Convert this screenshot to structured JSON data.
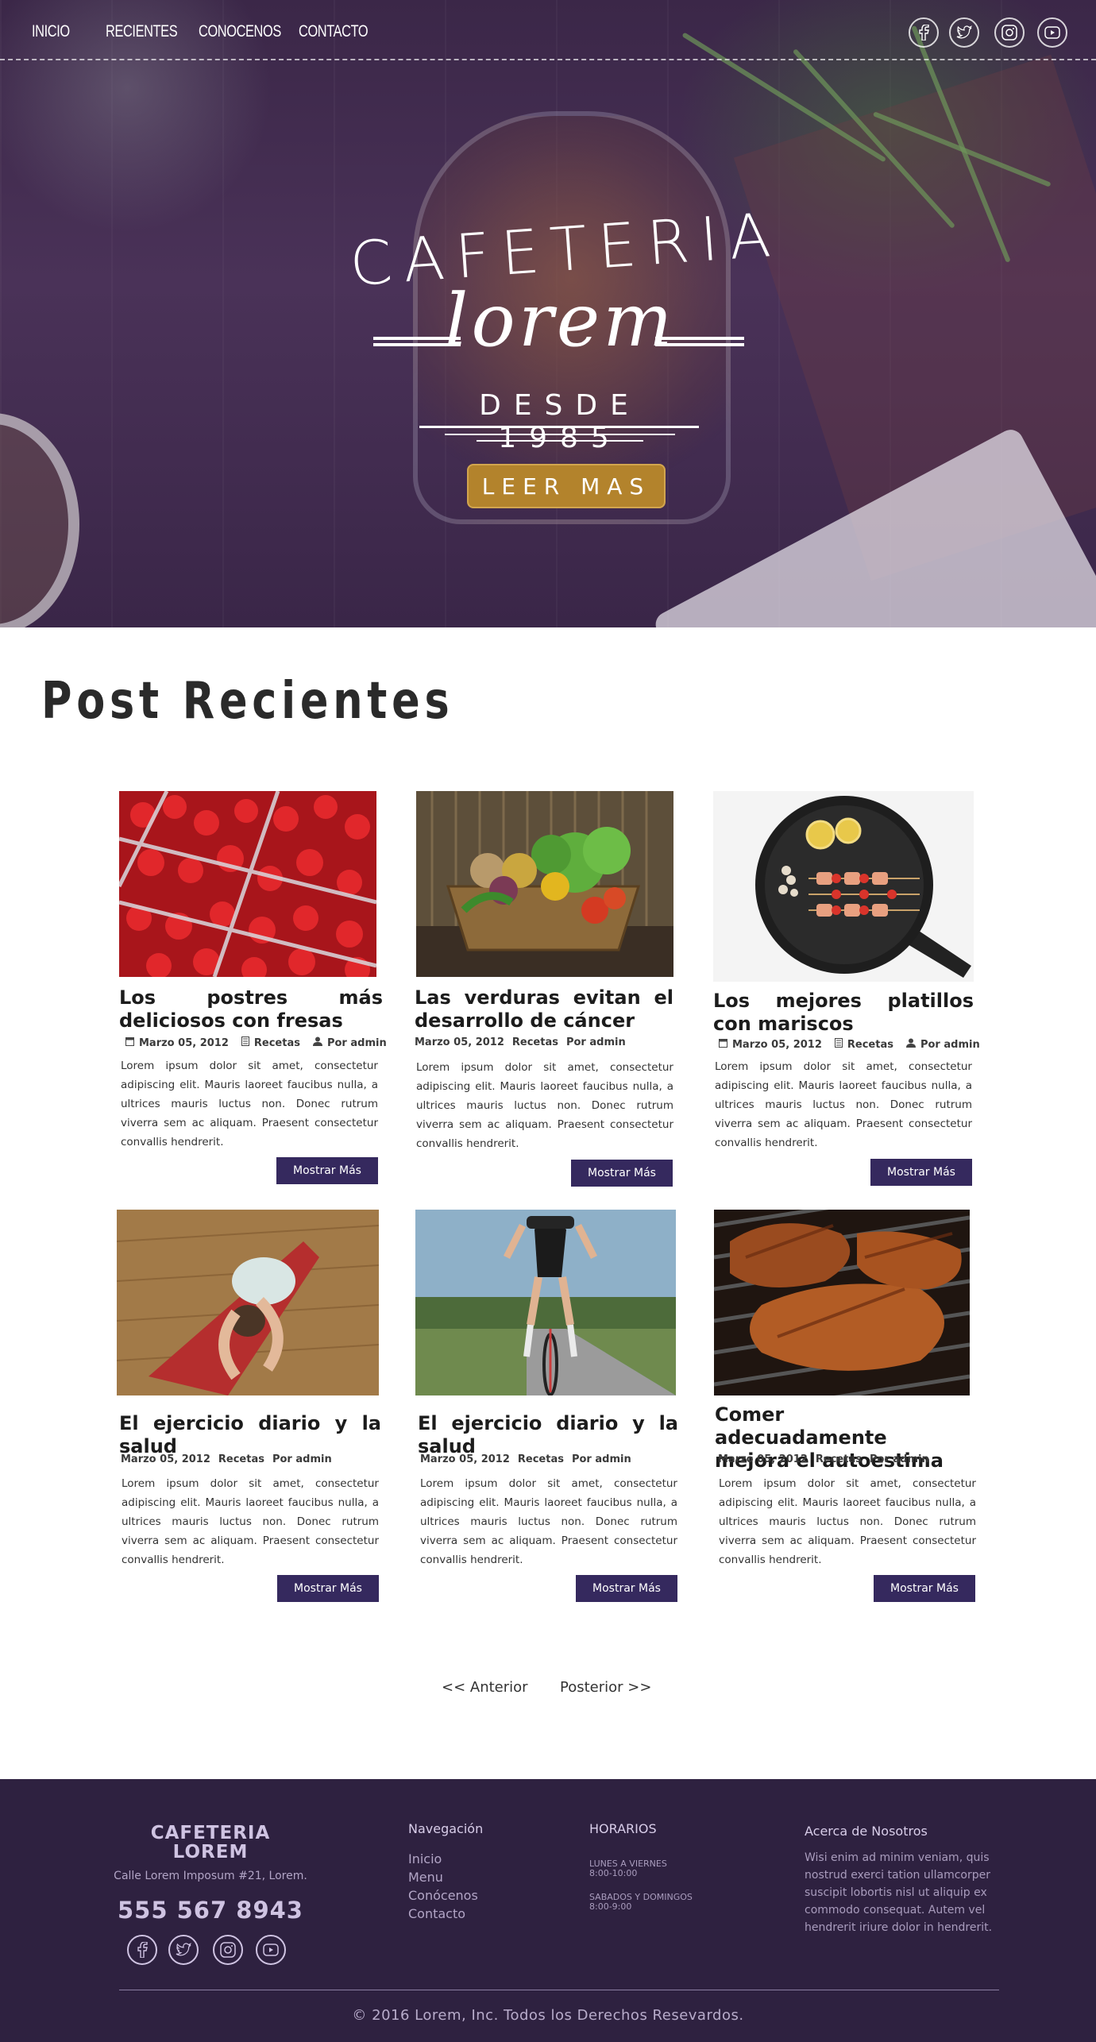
{
  "nav": {
    "links": [
      "INICIO",
      "RECIENTES",
      "CONOCENOS",
      "CONTACTO"
    ],
    "social_icons": [
      "facebook-icon",
      "twitter-icon",
      "instagram-icon",
      "youtube-icon"
    ]
  },
  "hero": {
    "title": "CAFETERIA",
    "script": "lorem",
    "since": "DESDE 1985",
    "cta_label": "LEER MAS",
    "cta_color": "#b3832c"
  },
  "posts": {
    "section_title": "Post Recientes",
    "button_color": "#35295e",
    "items": [
      {
        "title": "Los postres más deliciosos con fresas",
        "date": "Marzo 05, 2012",
        "category": "Recetas",
        "author": "Por admin",
        "text": "Lorem ipsum dolor sit amet, consectetur adipiscing elit. Mauris laoreet faucibus nulla, a ultrices mauris luctus non. Donec rutrum viverra sem ac aliquam. Praesent consectetur convallis hendrerit.",
        "button": "Mostrar Más"
      },
      {
        "title": "Las verduras evitan el desarrollo de cáncer",
        "date": "Marzo 05, 2012",
        "category": "Recetas",
        "author": "Por admin",
        "text": "Lorem ipsum dolor sit amet, consectetur adipiscing elit. Mauris laoreet faucibus nulla, a ultrices mauris luctus non. Donec rutrum viverra sem ac aliquam. Praesent consectetur convallis hendrerit.",
        "button": "Mostrar Más"
      },
      {
        "title": "Los mejores platillos con mariscos",
        "date": "Marzo 05, 2012",
        "category": "Recetas",
        "author": "Por admin",
        "text": "Lorem ipsum dolor sit amet, consectetur adipiscing elit. Mauris laoreet faucibus nulla, a ultrices mauris luctus non. Donec rutrum viverra sem ac aliquam. Praesent consectetur convallis hendrerit.",
        "button": "Mostrar Más"
      },
      {
        "title": "El ejercicio diario y la salud",
        "date": "Marzo 05, 2012",
        "category": "Recetas",
        "author": "Por admin",
        "text": "Lorem ipsum dolor sit amet, consectetur adipiscing elit. Mauris laoreet faucibus nulla, a ultrices mauris luctus non. Donec rutrum viverra sem ac aliquam. Praesent consectetur convallis hendrerit.",
        "button": "Mostrar Más"
      },
      {
        "title": "El ejercicio diario y la salud",
        "date": "Marzo 05, 2012",
        "category": "Recetas",
        "author": "Por admin",
        "text": "Lorem ipsum dolor sit amet, consectetur adipiscing elit. Mauris laoreet faucibus nulla, a ultrices mauris luctus non. Donec rutrum viverra sem ac aliquam. Praesent consectetur convallis hendrerit.",
        "button": "Mostrar Más"
      },
      {
        "title": "Comer adecuadamente mejora el autoestima",
        "date": "Marzo 05, 2012",
        "category": "Recetas",
        "author": "Por admin",
        "text": "Lorem ipsum dolor sit amet, consectetur adipiscing elit. Mauris laoreet faucibus nulla, a ultrices mauris luctus non. Donec rutrum viverra sem ac aliquam. Praesent consectetur convallis hendrerit.",
        "button": "Mostrar Más"
      }
    ]
  },
  "pagination": {
    "prev": "<< Anterior",
    "next": "Posterior >>"
  },
  "footer": {
    "brand_line1": "CAFETERIA",
    "brand_line2": "LOREM",
    "address": "Calle Lorem Imposum #21, Lorem.",
    "phone": "555 567 8943",
    "nav_title": "Navegación",
    "nav_links": [
      "Inicio",
      "Menu",
      "Conócenos",
      "Contacto"
    ],
    "hours_title": "HORARIOS",
    "hours": [
      {
        "days": "LUNES A VIERNES",
        "time": "8:00-10:00"
      },
      {
        "days": "SABADOS Y DOMINGOS",
        "time": "8:00-9:00"
      }
    ],
    "about_title": "Acerca de Nosotros",
    "about_text": "Wisi enim ad minim veniam, quis nostrud exerci tation ullamcorper suscipit lobortis nisl ut aliquip ex commodo consequat. Autem vel hendrerit iriure dolor in hendrerit.",
    "copyright": "© 2016 Lorem, Inc. Todos los Derechos Resevardos.",
    "background": "#2e2140"
  }
}
